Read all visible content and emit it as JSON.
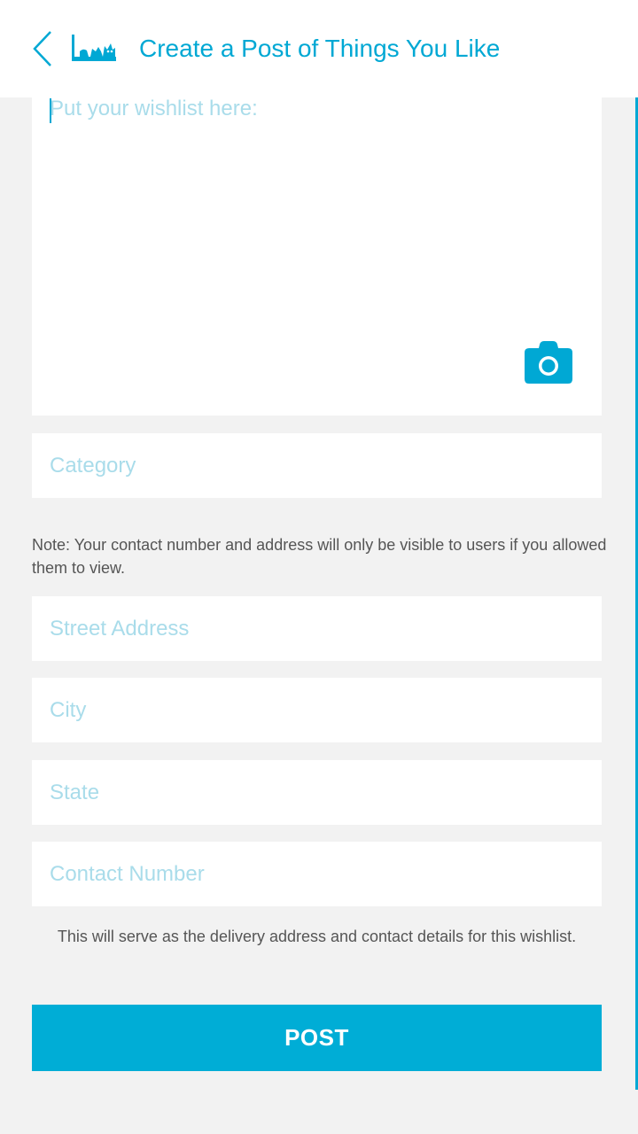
{
  "header": {
    "title": "Create a Post of Things You Like",
    "back_icon": "chevron-left-icon",
    "logo_icon": "cat-logo-icon"
  },
  "wishlist": {
    "placeholder": "Put your wishlist here:",
    "camera_icon": "camera-icon"
  },
  "category": {
    "placeholder": "Category"
  },
  "note": "Note: Your contact number and address will only be visible to users if you allowed them to view.",
  "address": {
    "street_placeholder": "Street Address",
    "city_placeholder": "City",
    "state_placeholder": "State",
    "contact_placeholder": "Contact Number"
  },
  "info": "This will serve as the delivery address and contact details for this wishlist.",
  "post_button": "POST",
  "colors": {
    "accent": "#00a8d4",
    "placeholder": "#a9dcea",
    "background": "#f2f2f2"
  }
}
